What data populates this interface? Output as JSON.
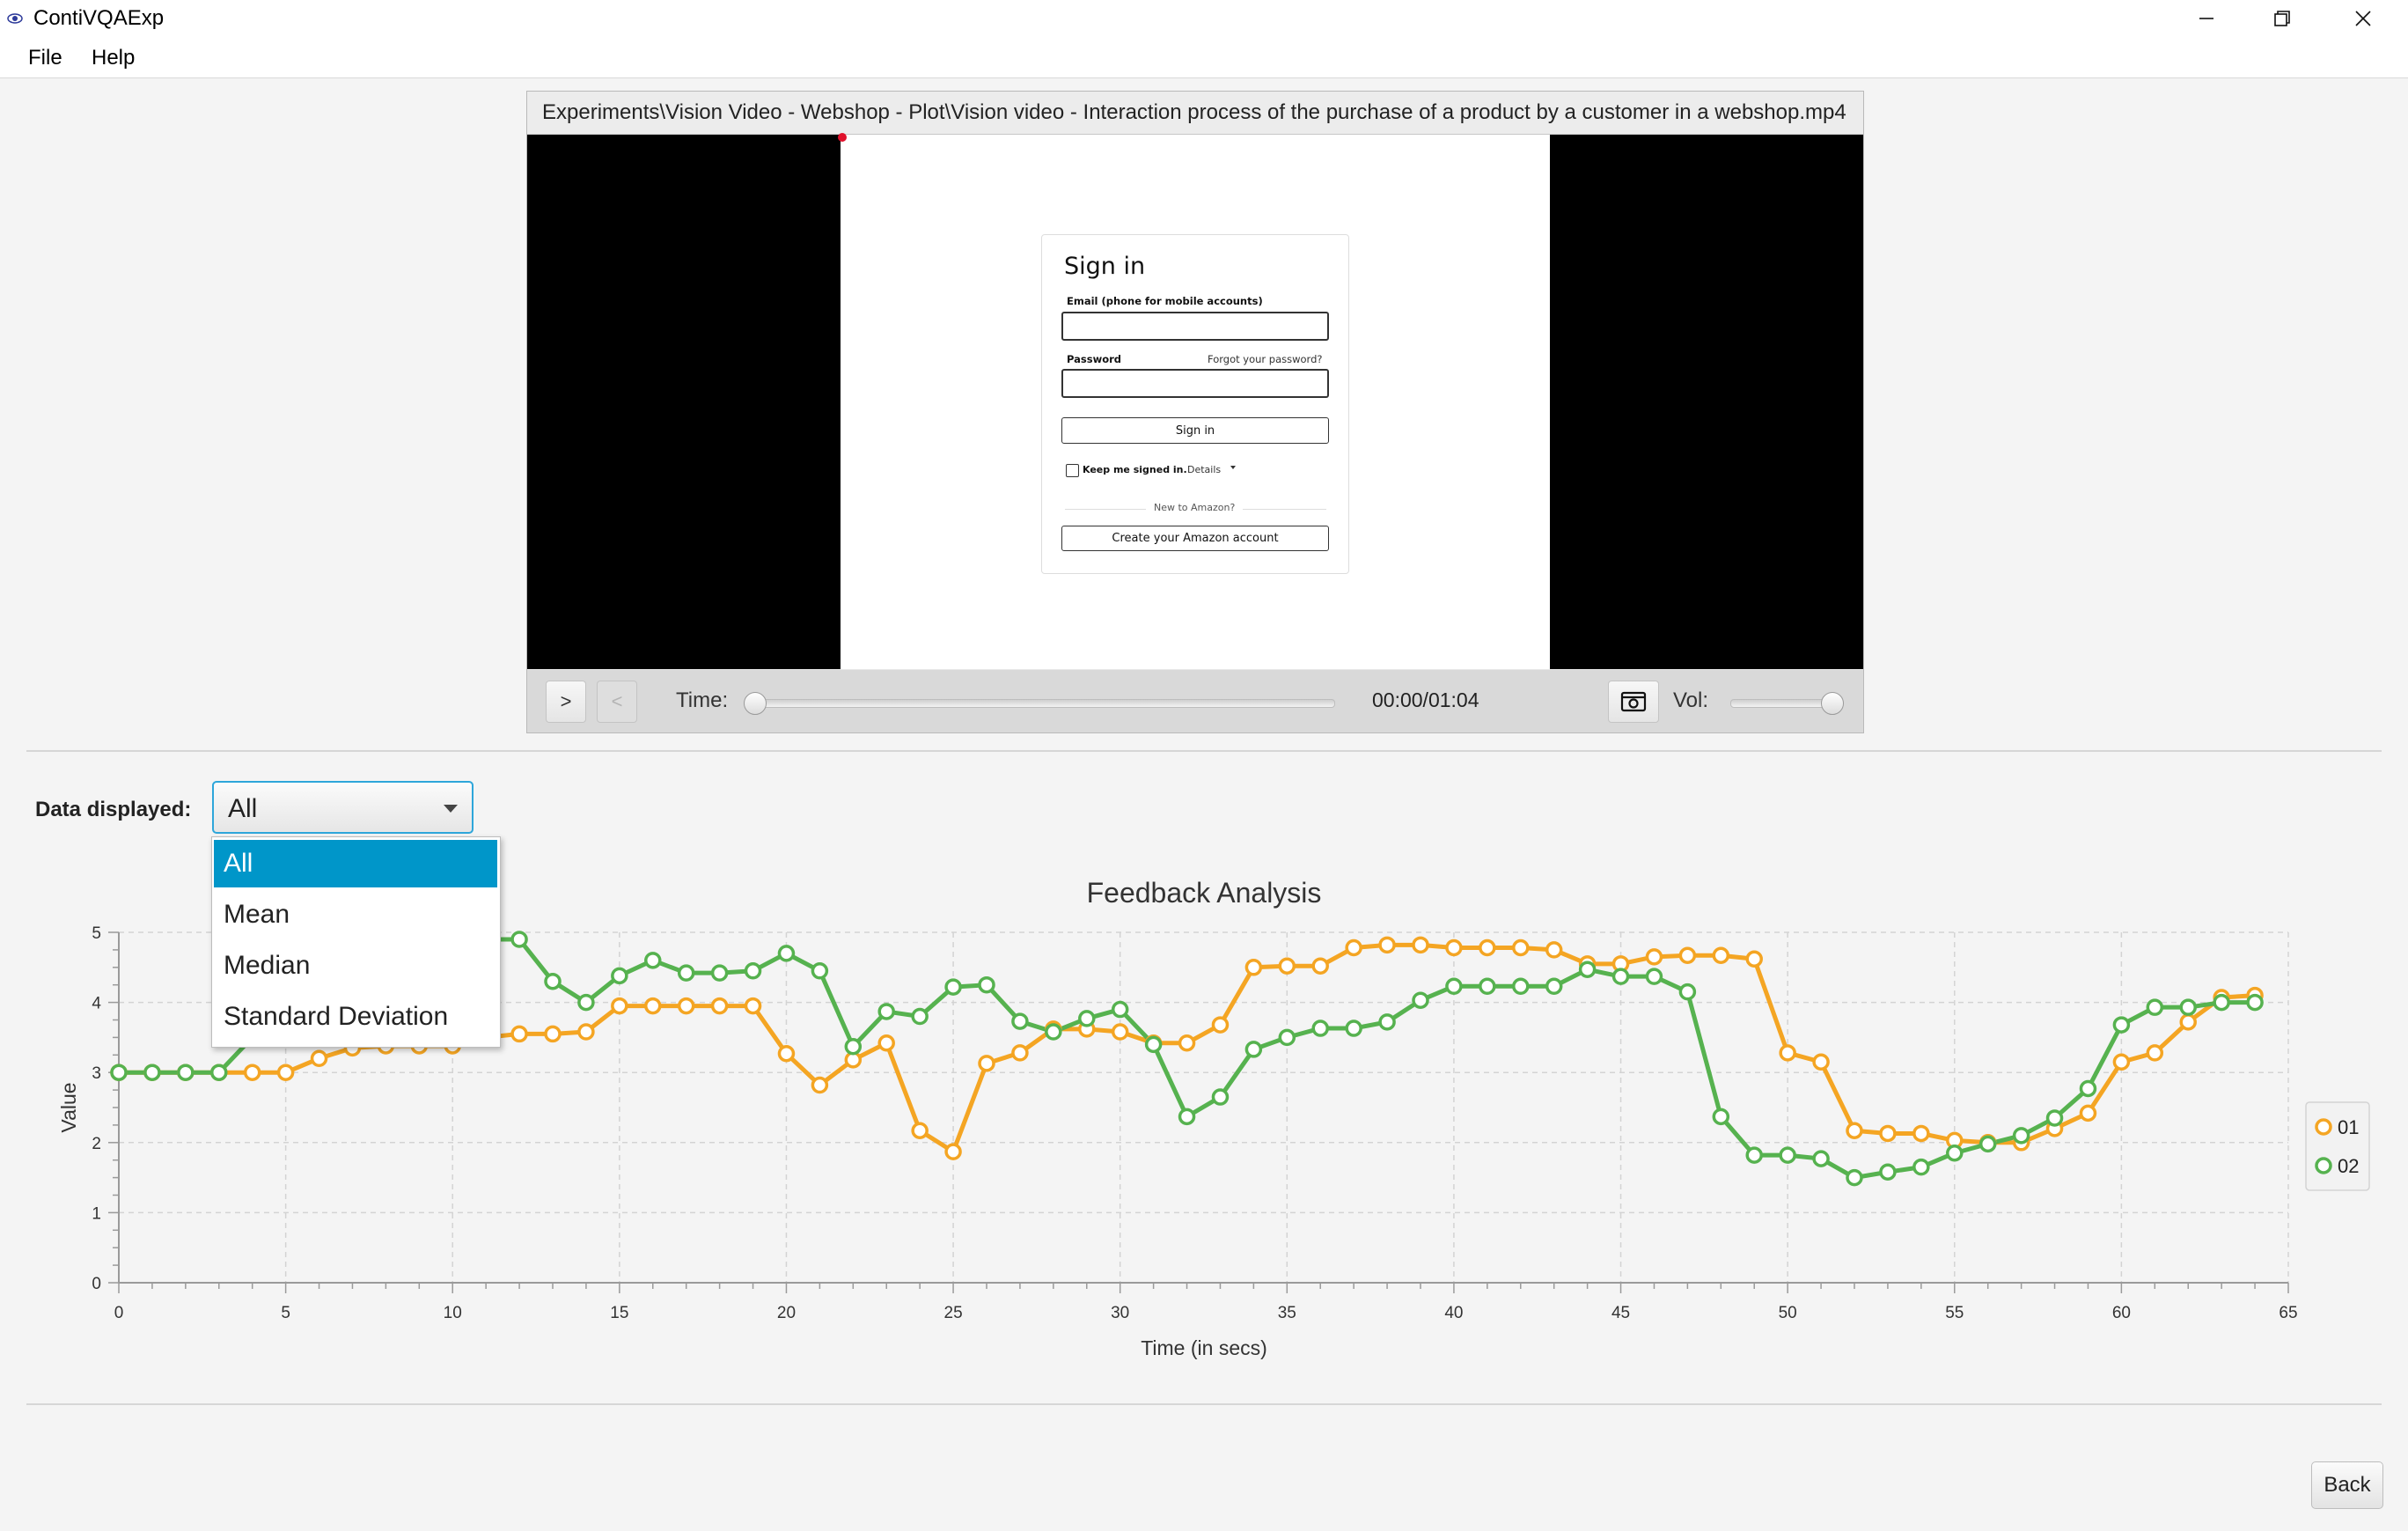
{
  "window": {
    "title": "ContiVQAExp",
    "icon": "eye-icon"
  },
  "menu": {
    "items": [
      "File",
      "Help"
    ]
  },
  "video": {
    "title": "Experiments\\Vision Video - Webshop - Plot\\Vision video - Interaction process of the purchase of a product by a customer in a webshop.mp4",
    "signin": {
      "title": "Sign in",
      "email_label": "Email (phone for mobile accounts)",
      "password_label": "Password",
      "forgot_link": "Forgot your password?",
      "signin_button": "Sign in",
      "keep_signed": "Keep me signed in.",
      "details": "Details",
      "new_to": "New to Amazon?",
      "create_button": "Create your Amazon account"
    },
    "controls": {
      "play_label": ">",
      "back_label": "<",
      "time_label": "Time:",
      "time_value": "00:00/01:04",
      "vol_label": "Vol:",
      "time_progress": 0.0,
      "volume": 1.0,
      "snapshot_icon": "camera-icon"
    }
  },
  "data_displayed": {
    "label": "Data displayed:",
    "selected": "All",
    "options": [
      "All",
      "Mean",
      "Median",
      "Standard Deviation"
    ]
  },
  "back_button": "Back",
  "chart_data": {
    "type": "line",
    "title": "Feedback Analysis",
    "xlabel": "Time (in secs)",
    "ylabel": "Value",
    "xlim": [
      0,
      65
    ],
    "ylim": [
      0,
      5
    ],
    "x_ticks": [
      0,
      5,
      10,
      15,
      20,
      25,
      30,
      35,
      40,
      45,
      50,
      55,
      60,
      65
    ],
    "y_ticks": [
      0,
      1,
      2,
      3,
      4,
      5
    ],
    "grid": true,
    "legend": "right",
    "series": [
      {
        "name": "01",
        "color": "#f4a523",
        "x": [
          0,
          1,
          2,
          3,
          4,
          5,
          6,
          7,
          8,
          9,
          10,
          11,
          12,
          13,
          14,
          15,
          16,
          17,
          18,
          19,
          20,
          21,
          22,
          23,
          24,
          25,
          26,
          27,
          28,
          29,
          30,
          31,
          32,
          33,
          34,
          35,
          36,
          37,
          38,
          39,
          40,
          41,
          42,
          43,
          44,
          45,
          46,
          47,
          48,
          49,
          50,
          51,
          52,
          53,
          54,
          55,
          56,
          57,
          58,
          59,
          60,
          61,
          62,
          63,
          64
        ],
        "y": [
          3,
          3,
          3,
          3,
          3,
          3,
          3.2,
          3.35,
          3.38,
          3.38,
          3.38,
          3.5,
          3.55,
          3.55,
          3.58,
          3.95,
          3.95,
          3.95,
          3.95,
          3.95,
          3.27,
          2.82,
          3.18,
          3.42,
          2.17,
          1.87,
          3.13,
          3.28,
          3.62,
          3.62,
          3.58,
          3.42,
          3.42,
          3.68,
          4.5,
          4.52,
          4.52,
          4.78,
          4.82,
          4.82,
          4.78,
          4.78,
          4.78,
          4.75,
          4.55,
          4.55,
          4.65,
          4.67,
          4.67,
          4.62,
          3.28,
          3.15,
          2.17,
          2.13,
          2.13,
          2.03,
          2.0,
          2.0,
          2.2,
          2.42,
          3.15,
          3.28,
          3.72,
          4.07,
          4.1
        ]
      },
      {
        "name": "02",
        "color": "#56b24f",
        "x": [
          0,
          1,
          2,
          3,
          4,
          5,
          6,
          7,
          8,
          9,
          10,
          11,
          12,
          13,
          14,
          15,
          16,
          17,
          18,
          19,
          20,
          21,
          22,
          23,
          24,
          25,
          26,
          27,
          28,
          29,
          30,
          31,
          32,
          33,
          34,
          35,
          36,
          37,
          38,
          39,
          40,
          41,
          42,
          43,
          44,
          45,
          46,
          47,
          48,
          49,
          50,
          51,
          52,
          53,
          54,
          55,
          56,
          57,
          58,
          59,
          60,
          61,
          62,
          63,
          64
        ],
        "y": [
          3,
          3,
          3,
          3,
          3.5,
          4.0,
          4.4,
          4.7,
          4.85,
          4.9,
          4.9,
          4.9,
          4.9,
          4.3,
          4.0,
          4.38,
          4.6,
          4.42,
          4.42,
          4.45,
          4.7,
          4.45,
          3.37,
          3.87,
          3.8,
          4.22,
          4.25,
          3.73,
          3.58,
          3.77,
          3.9,
          3.4,
          2.37,
          2.65,
          3.33,
          3.5,
          3.63,
          3.63,
          3.72,
          4.03,
          4.23,
          4.23,
          4.23,
          4.23,
          4.47,
          4.37,
          4.37,
          4.15,
          2.37,
          1.82,
          1.82,
          1.77,
          1.5,
          1.58,
          1.65,
          1.85,
          1.98,
          2.1,
          2.35,
          2.77,
          3.68,
          3.93,
          3.93,
          4.0,
          4.0
        ]
      }
    ]
  }
}
